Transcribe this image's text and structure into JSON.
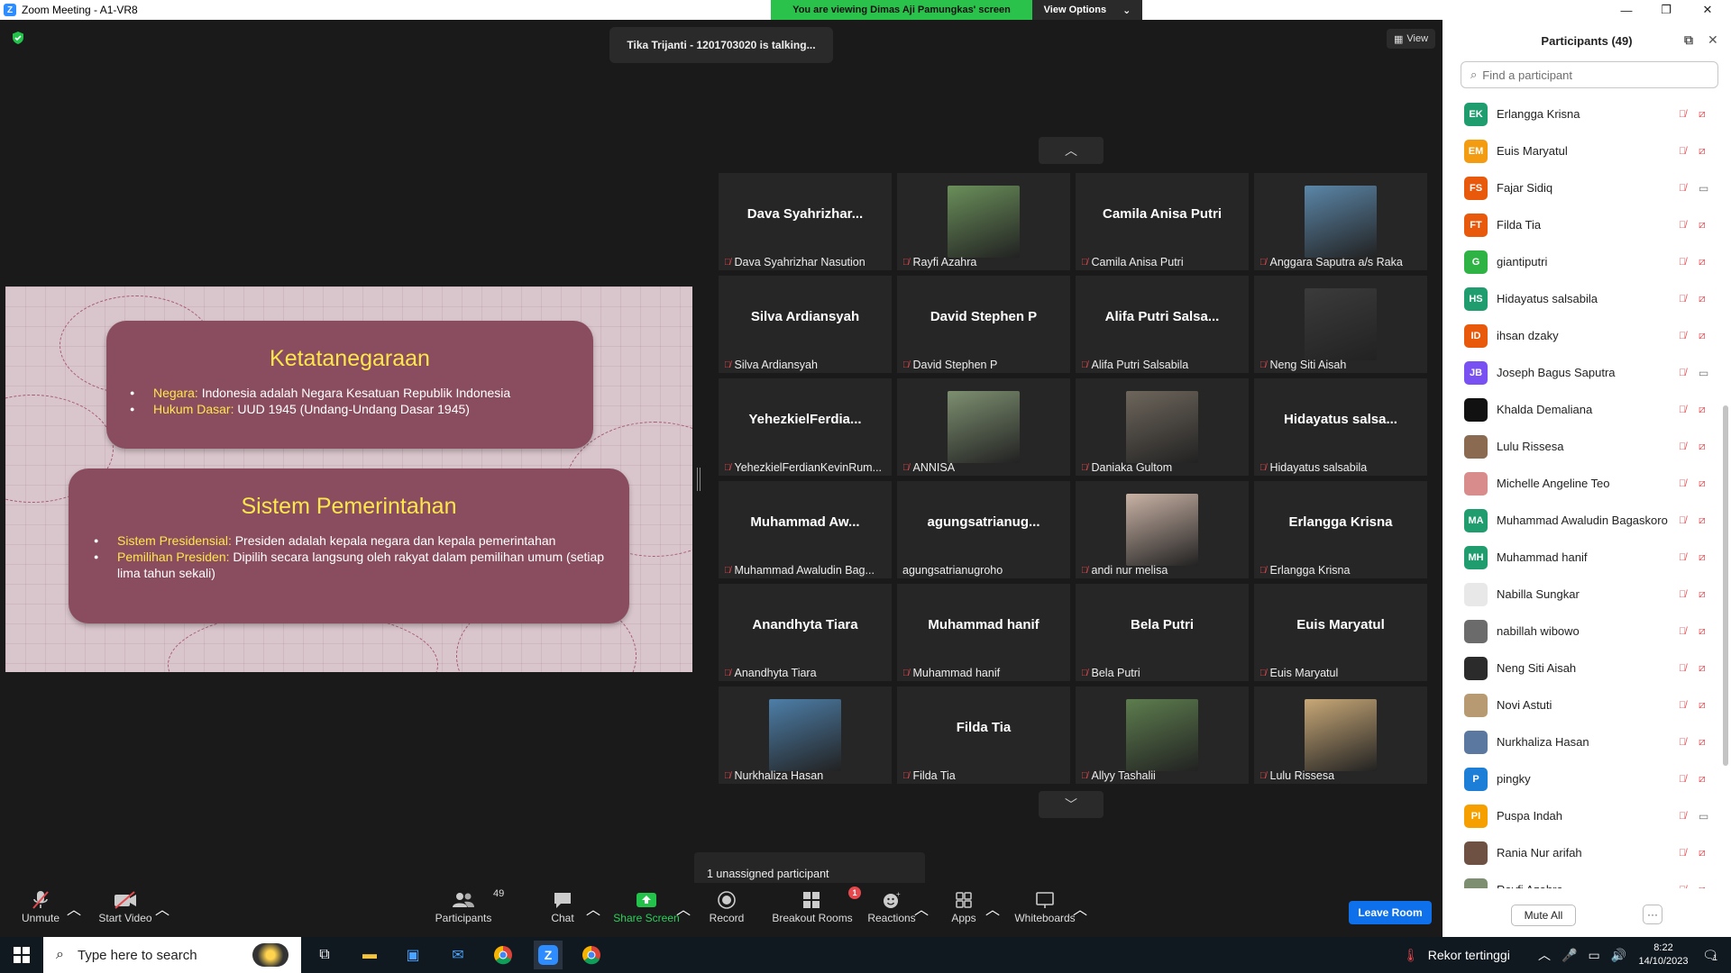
{
  "window": {
    "title": "Zoom Meeting - A1-VR8"
  },
  "share_banner": {
    "text": "You are viewing Dimas Aji Pamungkas' screen",
    "options_label": "View Options"
  },
  "talking": "Tika Trijanti  - 1201703020 is talking...",
  "view_button": "View",
  "slide": {
    "card1": {
      "title": "Ketatanegaraan",
      "items": [
        {
          "key": "Negara:",
          "text": " Indonesia adalah Negara Kesatuan Republik Indonesia"
        },
        {
          "key": "Hukum Dasar:",
          "text": " UUD 1945 (Undang-Undang Dasar 1945)"
        }
      ]
    },
    "card2": {
      "title": "Sistem Pemerintahan",
      "items": [
        {
          "key": "Sistem Presidensial:",
          "text": " Presiden adalah kepala negara dan kepala pemerintahan"
        },
        {
          "key": "Pemilihan Presiden:",
          "text": " Dipilih secara langsung oleh rakyat dalam pemilihan umum (setiap lima tahun sekali)"
        }
      ]
    }
  },
  "gallery": [
    {
      "big": "Dava  Syahrizhar...",
      "label": "Dava Syahrizhar Nasution",
      "muted": true
    },
    {
      "big": "",
      "label": "Rayfi Azahra",
      "muted": true,
      "photo": "#6a8f5a"
    },
    {
      "big": "Camila Anisa Putri",
      "label": "Camila Anisa Putri",
      "muted": true
    },
    {
      "big": "",
      "label": "Anggara Saputra a/s Raka",
      "muted": true,
      "photo": "#5b86a8"
    },
    {
      "big": "Silva Ardiansyah",
      "label": "Silva Ardiansyah",
      "muted": true
    },
    {
      "big": "David Stephen P",
      "label": "David Stephen P",
      "muted": true
    },
    {
      "big": "Alifa  Putri  Salsa...",
      "label": "Alifa Putri Salsabila",
      "muted": true
    },
    {
      "big": "",
      "label": "Neng Siti Aisah",
      "muted": true,
      "photo": "#3b3b3b"
    },
    {
      "big": "YehezkielFerdia...",
      "label": "YehezkielFerdianKevinRum...",
      "muted": true
    },
    {
      "big": "",
      "label": "ANNISA",
      "muted": true,
      "photo": "#7d8f70"
    },
    {
      "big": "",
      "label": "Daniaka Gultom",
      "muted": true,
      "photo": "#6e665c"
    },
    {
      "big": "Hidayatus  salsa...",
      "label": "Hidayatus salsabila",
      "muted": true
    },
    {
      "big": "Muhammad  Aw...",
      "label": "Muhammad Awaludin Bag...",
      "muted": true
    },
    {
      "big": "agungsatrianug...",
      "label": "agungsatrianugroho",
      "muted": false
    },
    {
      "big": "",
      "label": "andi nur melisa",
      "muted": true,
      "photo": "#c9b2a5"
    },
    {
      "big": "Erlangga Krisna",
      "label": "Erlangga Krisna",
      "muted": true
    },
    {
      "big": "Anandhyta Tiara",
      "label": "Anandhyta Tiara",
      "muted": true
    },
    {
      "big": "Muhammad hanif",
      "label": "Muhammad hanif",
      "muted": true
    },
    {
      "big": "Bela Putri",
      "label": "Bela Putri",
      "muted": true
    },
    {
      "big": "Euis Maryatul",
      "label": "Euis Maryatul",
      "muted": true
    },
    {
      "big": "",
      "label": "Nurkhaliza Hasan",
      "muted": true,
      "photo": "#4d7ea8"
    },
    {
      "big": "Filda Tia",
      "label": "Filda Tia",
      "muted": true
    },
    {
      "big": "",
      "label": "Allyy Tashalii",
      "muted": true,
      "photo": "#5d7d4e"
    },
    {
      "big": "",
      "label": "Lulu Rissesa",
      "muted": true,
      "photo": "#c8a877"
    }
  ],
  "unassigned": "1 unassigned participant",
  "toolbar": {
    "unmute": "Unmute",
    "start_video": "Start Video",
    "participants": "Participants",
    "participants_count": "49",
    "chat": "Chat",
    "share_screen": "Share Screen",
    "record": "Record",
    "breakout_rooms": "Breakout Rooms",
    "breakout_badge": "1",
    "reactions": "Reactions",
    "apps": "Apps",
    "whiteboards": "Whiteboards",
    "leave_room": "Leave Room"
  },
  "panel": {
    "title": "Participants (49)",
    "search_placeholder": "Find a participant",
    "mute_all": "Mute All",
    "more": "···",
    "participants": [
      {
        "initials": "EK",
        "color": "#1f9d6e",
        "name": "Erlangga Krisna",
        "video": false
      },
      {
        "initials": "EM",
        "color": "#f39c12",
        "name": "Euis Maryatul",
        "video": false
      },
      {
        "initials": "FS",
        "color": "#e8590c",
        "name": "Fajar Sidiq",
        "video": true
      },
      {
        "initials": "FT",
        "color": "#e8590c",
        "name": "Filda Tia",
        "video": false
      },
      {
        "initials": "G",
        "color": "#2fb344",
        "name": "giantiputri",
        "video": false
      },
      {
        "initials": "HS",
        "color": "#1f9d6e",
        "name": "Hidayatus salsabila",
        "video": false
      },
      {
        "initials": "ID",
        "color": "#e8590c",
        "name": "ihsan dzaky",
        "video": false
      },
      {
        "initials": "JB",
        "color": "#7950f2",
        "name": "Joseph Bagus Saputra",
        "video": true
      },
      {
        "initials": "",
        "color": "#111111",
        "name": "Khalda Demaliana",
        "video": false
      },
      {
        "initials": "",
        "color": "#8a6a50",
        "name": "Lulu Rissesa",
        "video": false
      },
      {
        "initials": "",
        "color": "#d98c8c",
        "name": "Michelle Angeline Teo",
        "video": false
      },
      {
        "initials": "MA",
        "color": "#1f9d6e",
        "name": "Muhammad Awaludin Bagaskoro",
        "video": false
      },
      {
        "initials": "MH",
        "color": "#1f9d6e",
        "name": "Muhammad hanif",
        "video": false
      },
      {
        "initials": "",
        "color": "#e8e8e8",
        "name": "Nabilla Sungkar",
        "video": false
      },
      {
        "initials": "",
        "color": "#6b6b6b",
        "name": "nabillah wibowo",
        "video": false
      },
      {
        "initials": "",
        "color": "#2b2b2b",
        "name": "Neng Siti Aisah",
        "video": false
      },
      {
        "initials": "",
        "color": "#b89a72",
        "name": "Novi Astuti",
        "video": false
      },
      {
        "initials": "",
        "color": "#5a78a0",
        "name": "Nurkhaliza Hasan",
        "video": false
      },
      {
        "initials": "P",
        "color": "#1c7ed6",
        "name": "pingky",
        "video": false
      },
      {
        "initials": "PI",
        "color": "#f59f00",
        "name": "Puspa Indah",
        "video": true
      },
      {
        "initials": "",
        "color": "#6e5142",
        "name": "Rania Nur arifah",
        "video": false
      },
      {
        "initials": "",
        "color": "#7d8f70",
        "name": "Rayfi Azahra",
        "video": false
      }
    ]
  },
  "taskbar": {
    "search_placeholder": "Type here to search",
    "weather": "Rekor tertinggi",
    "time": "8:22",
    "date": "14/10/2023",
    "notification_count": "1"
  }
}
